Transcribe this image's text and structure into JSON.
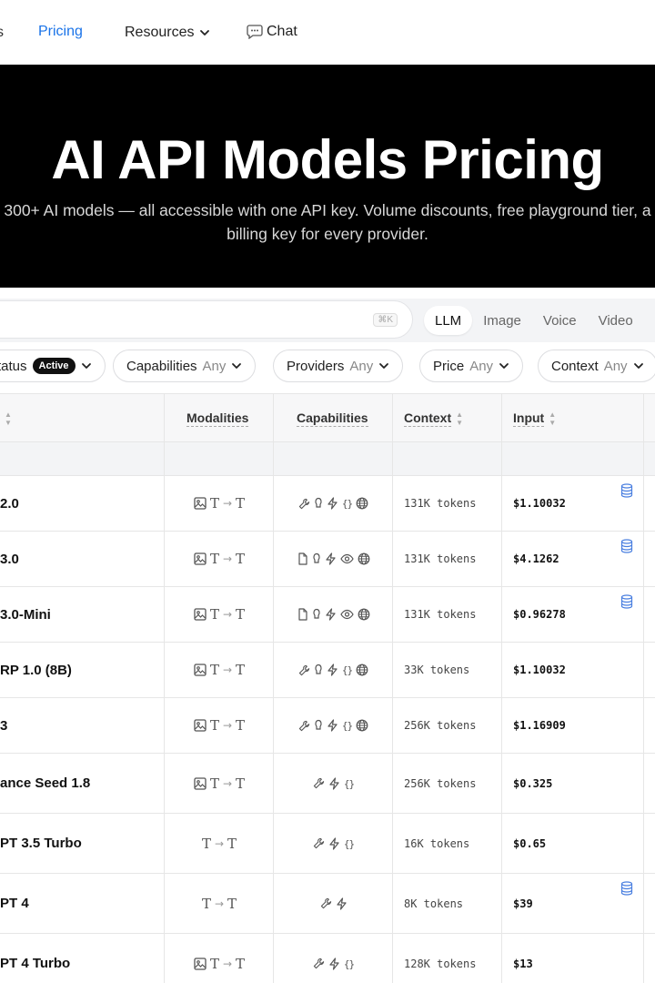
{
  "nav": {
    "cut_item": "s",
    "pricing": "Pricing",
    "resources": "Resources",
    "chat": "Chat"
  },
  "hero": {
    "title": "AI API Models Pricing",
    "subtitle_line1": "300+ AI models — all accessible with one API key. Volume discounts, free playground tier, a",
    "subtitle_line2": "billing key for every provider."
  },
  "search": {
    "shortcut": "⌘K"
  },
  "type_tabs": [
    "LLM",
    "Image",
    "Voice",
    "Video"
  ],
  "filters": {
    "status": {
      "label": "Status",
      "badge": "Active"
    },
    "capabilities": {
      "label": "Capabilities",
      "value": "Any"
    },
    "providers": {
      "label": "Providers",
      "value": "Any"
    },
    "price": {
      "label": "Price",
      "value": "Any"
    },
    "context": {
      "label": "Context",
      "value": "Any"
    }
  },
  "table": {
    "headers": {
      "modalities": "Modalities",
      "capabilities": "Capabilities",
      "context": "Context",
      "input": "Input"
    },
    "rows": [
      {
        "name": "2.0",
        "modalities": "image-text-to-text",
        "in": "T",
        "out": "T",
        "caps": [
          "tool-icon",
          "reasoning-icon",
          "bolt-icon",
          "json-icon",
          "web-icon"
        ],
        "context": "131K tokens",
        "input": "$1.10032",
        "cache": true
      },
      {
        "name": "3.0",
        "modalities": "image-text-to-text",
        "in": "T",
        "out": "T",
        "caps": [
          "file-icon",
          "reasoning-icon",
          "bolt-icon",
          "eye-icon",
          "web-icon"
        ],
        "context": "131K tokens",
        "input": "$4.1262",
        "cache": true
      },
      {
        "name": "3.0-Mini",
        "modalities": "image-text-to-text",
        "in": "T",
        "out": "T",
        "caps": [
          "file-icon",
          "reasoning-icon",
          "bolt-icon",
          "eye-icon",
          "web-icon"
        ],
        "context": "131K tokens",
        "input": "$0.96278",
        "cache": true
      },
      {
        "name": "RP 1.0 (8B)",
        "modalities": "image-text-to-text",
        "in": "T",
        "out": "T",
        "caps": [
          "tool-icon",
          "reasoning-icon",
          "bolt-icon",
          "json-icon",
          "web-icon"
        ],
        "context": "33K tokens",
        "input": "$1.10032",
        "cache": false
      },
      {
        "name": "3",
        "modalities": "image-text-to-text",
        "in": "T",
        "out": "T",
        "caps": [
          "tool-icon",
          "reasoning-icon",
          "bolt-icon",
          "json-icon",
          "web-icon"
        ],
        "context": "256K tokens",
        "input": "$1.16909",
        "cache": false
      },
      {
        "name": "ance Seed 1.8",
        "modalities": "image-text-to-text",
        "in": "T",
        "out": "T",
        "caps": [
          "tool-icon",
          "bolt-icon",
          "json-icon"
        ],
        "context": "256K tokens",
        "input": "$0.325",
        "cache": false
      },
      {
        "name": "PT 3.5 Turbo",
        "modalities": "text-to-text",
        "in": "T",
        "out": "T",
        "caps": [
          "tool-icon",
          "bolt-icon",
          "json-icon"
        ],
        "context": "16K tokens",
        "input": "$0.65",
        "cache": false
      },
      {
        "name": "PT 4",
        "modalities": "text-to-text",
        "in": "T",
        "out": "T",
        "caps": [
          "tool-icon",
          "bolt-icon"
        ],
        "context": "8K tokens",
        "input": "$39",
        "cache": true
      },
      {
        "name": "PT 4 Turbo",
        "modalities": "image-text-to-text",
        "in": "T",
        "out": "T",
        "caps": [
          "tool-icon",
          "bolt-icon",
          "json-icon"
        ],
        "context": "128K tokens",
        "input": "$13",
        "cache": false
      }
    ]
  },
  "colors": {
    "accent": "#1a73e8",
    "hero_bg": "#000000",
    "cache_icon": "#4a7fe0"
  }
}
